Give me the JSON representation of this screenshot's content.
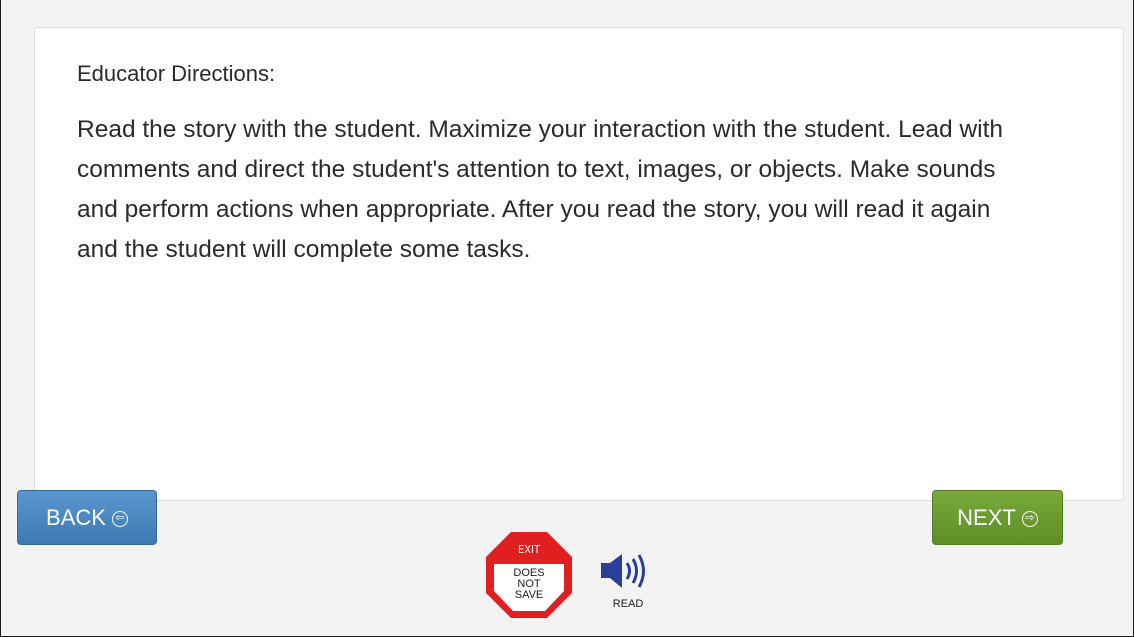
{
  "directions": {
    "title": "Educator Directions:",
    "body": "Read the story with the student. Maximize your interaction with the student. Lead with comments and direct the student's attention to text, images, or objects. Make sounds and perform actions when appropriate. After you read the story, you will read it again and the student will complete some tasks."
  },
  "nav": {
    "back_label": "BACK",
    "next_label": "NEXT"
  },
  "exit": {
    "label": "EXIT",
    "lines": [
      "DOES",
      "NOT",
      "SAVE"
    ]
  },
  "read": {
    "label": "READ"
  },
  "colors": {
    "back_button": "#4a89c4",
    "next_button": "#6c9b30",
    "exit_red": "#e02020",
    "speaker_blue": "#2a3f9c"
  }
}
